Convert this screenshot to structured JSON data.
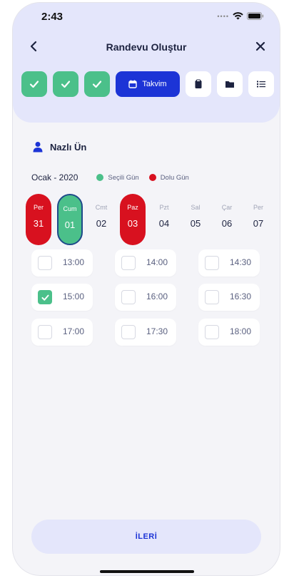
{
  "status_bar": {
    "time": "2:43"
  },
  "nav": {
    "title": "Randevu Oluştur"
  },
  "steps": {
    "active_label": "Takvim"
  },
  "user": {
    "name": "Nazlı Ün"
  },
  "calendar": {
    "month": "Ocak - 2020",
    "legend_selected": "Seçili Gün",
    "legend_full": "Dolu Gün",
    "colors": {
      "selected": "#4bc08a",
      "full": "#d8111f",
      "accent": "#1c34d6"
    },
    "days": [
      {
        "name": "Per",
        "num": "31",
        "state": "full"
      },
      {
        "name": "Cum",
        "num": "01",
        "state": "selected"
      },
      {
        "name": "Cmt",
        "num": "02",
        "state": "normal"
      },
      {
        "name": "Paz",
        "num": "03",
        "state": "full"
      },
      {
        "name": "Pzt",
        "num": "04",
        "state": "normal"
      },
      {
        "name": "Sal",
        "num": "05",
        "state": "normal"
      },
      {
        "name": "Çar",
        "num": "06",
        "state": "normal"
      },
      {
        "name": "Per",
        "num": "07",
        "state": "normal"
      }
    ]
  },
  "slots": [
    {
      "time": "13:00",
      "checked": false
    },
    {
      "time": "14:00",
      "checked": false
    },
    {
      "time": "14:30",
      "checked": false
    },
    {
      "time": "15:00",
      "checked": true
    },
    {
      "time": "16:00",
      "checked": false
    },
    {
      "time": "16:30",
      "checked": false
    },
    {
      "time": "17:00",
      "checked": false
    },
    {
      "time": "17:30",
      "checked": false
    },
    {
      "time": "18:00",
      "checked": false
    }
  ],
  "footer": {
    "next_label": "İLERİ"
  }
}
